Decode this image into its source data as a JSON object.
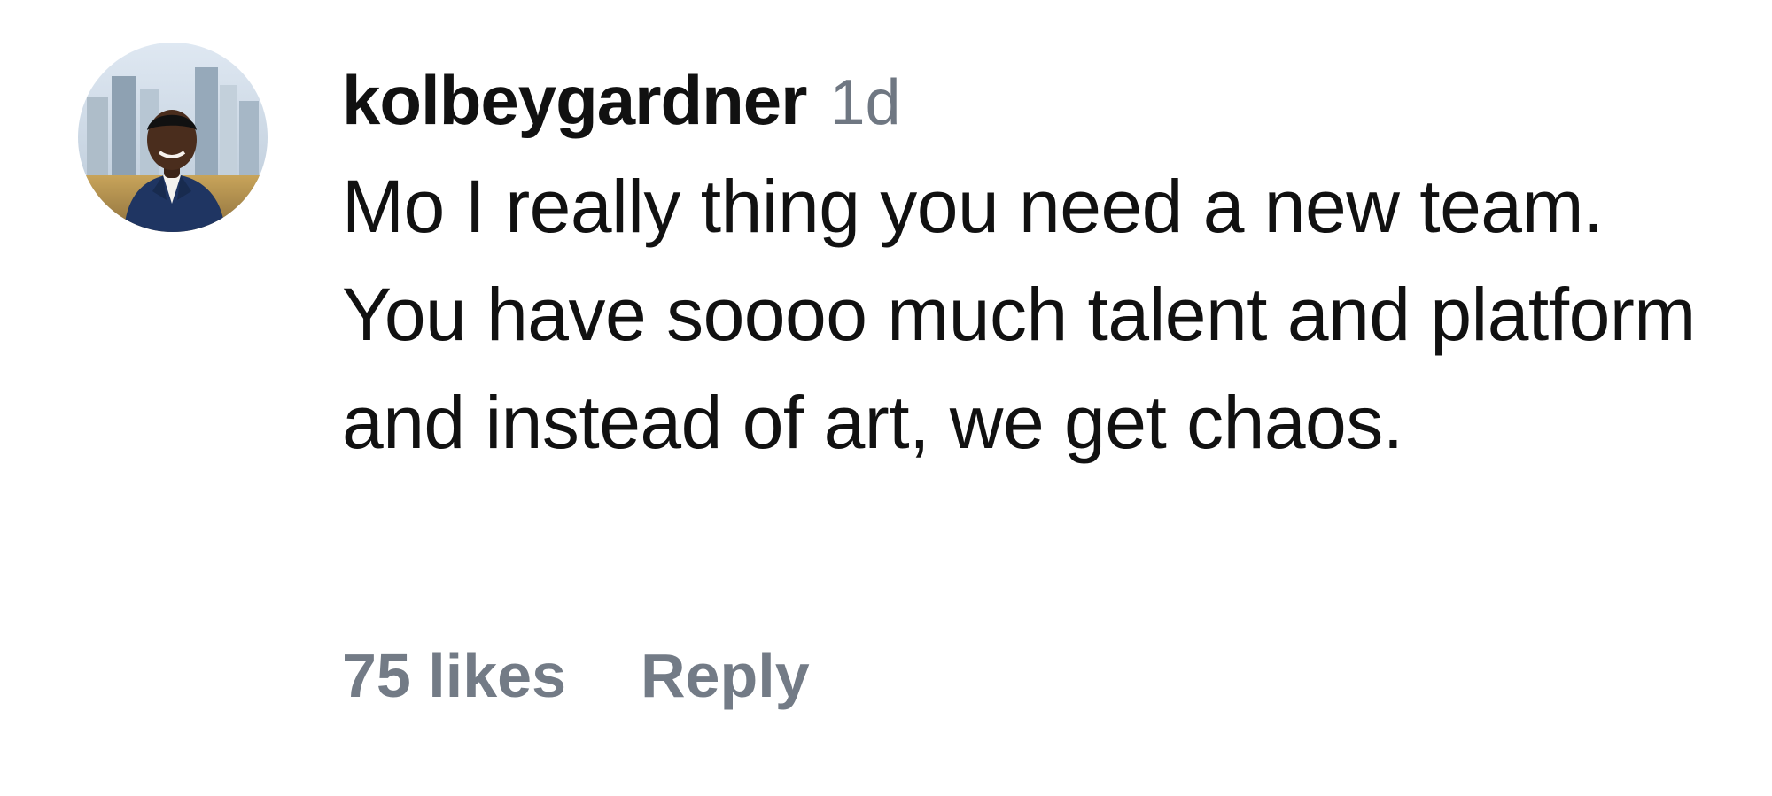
{
  "comment": {
    "avatar_icon": "user-avatar-photo",
    "username": "kolbeygardner",
    "timestamp": "1d",
    "text": "Mo I really thing you need a new team. You have soooo much talent and platform and instead of art, we get chaos.",
    "likes_label": "75 likes",
    "reply_label": "Reply"
  },
  "colors": {
    "text_primary": "#111111",
    "text_secondary": "#737b86",
    "background": "#ffffff"
  }
}
